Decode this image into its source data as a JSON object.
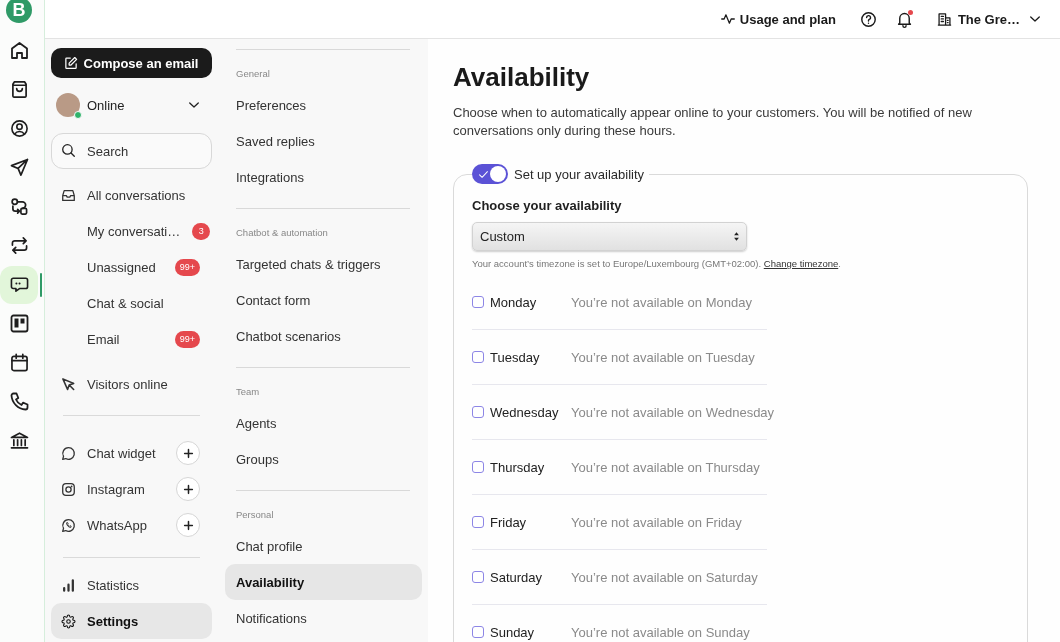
{
  "rail": {
    "logo": "B",
    "items": [
      {
        "selected": false
      },
      {
        "selected": false
      },
      {
        "selected": false
      },
      {
        "selected": false
      },
      {
        "selected": false
      },
      {
        "selected": false
      },
      {
        "selected": true
      },
      {
        "selected": false
      },
      {
        "selected": false
      },
      {
        "selected": false
      },
      {
        "selected": false
      }
    ]
  },
  "header": {
    "usage": "Usage and plan",
    "notifications": {
      "unread": true
    },
    "account": "The Gre…"
  },
  "nav": {
    "compose": "Compose an email",
    "status": {
      "label": "Online"
    },
    "search": {
      "placeholder": "Search"
    },
    "inbox": {
      "label": "All conversations",
      "selected": false,
      "children": [
        {
          "label": "My conversati…",
          "badge": "3",
          "selected": false
        },
        {
          "label": "Unassigned",
          "badge": "99+",
          "selected": false
        },
        {
          "label": "Chat & social",
          "selected": false
        },
        {
          "label": "Email",
          "badge": "99+",
          "selected": false
        }
      ]
    },
    "visitors": {
      "label": "Visitors online",
      "selected": false
    },
    "channels": [
      {
        "label": "Chat widget",
        "selected": false
      },
      {
        "label": "Instagram",
        "selected": false
      },
      {
        "label": "WhatsApp",
        "selected": false
      }
    ],
    "bottom": [
      {
        "label": "Statistics",
        "selected": false
      },
      {
        "label": "Settings",
        "selected": true
      }
    ]
  },
  "menu": {
    "sections": [
      {
        "title": "General",
        "items": [
          {
            "label": "Preferences",
            "selected": false
          },
          {
            "label": "Saved replies",
            "selected": false
          },
          {
            "label": "Integrations",
            "selected": false
          }
        ]
      },
      {
        "title": "Chatbot & automation",
        "items": [
          {
            "label": "Targeted chats & triggers",
            "selected": false
          },
          {
            "label": "Contact form",
            "selected": false
          },
          {
            "label": "Chatbot scenarios",
            "selected": false
          }
        ]
      },
      {
        "title": "Team",
        "items": [
          {
            "label": "Agents",
            "selected": false
          },
          {
            "label": "Groups",
            "selected": false
          }
        ]
      },
      {
        "title": "Personal",
        "items": [
          {
            "label": "Chat profile",
            "selected": false
          },
          {
            "label": "Availability",
            "selected": true
          },
          {
            "label": "Notifications",
            "selected": false
          }
        ]
      }
    ]
  },
  "page": {
    "title": "Availability",
    "description": "Choose when to automatically appear online to your customers. You will be notified of new conversations only during these hours.",
    "toggle": {
      "label": "Set up your availability",
      "on": true
    },
    "choose_label": "Choose your availability",
    "select": {
      "value": "Custom"
    },
    "hint": {
      "text": "Your account’s timezone is set to Europe/Luxembourg (GMT+02:00).",
      "link": "Change timezone",
      "end": "."
    },
    "days": [
      {
        "day": "Monday",
        "checked": false,
        "status": "You’re not available on Monday"
      },
      {
        "day": "Tuesday",
        "checked": false,
        "status": "You’re not available on Tuesday"
      },
      {
        "day": "Wednesday",
        "checked": false,
        "status": "You’re not available on Wednesday"
      },
      {
        "day": "Thursday",
        "checked": false,
        "status": "You’re not available on Thursday"
      },
      {
        "day": "Friday",
        "checked": false,
        "status": "You’re not available on Friday"
      },
      {
        "day": "Saturday",
        "checked": false,
        "status": "You’re not available on Saturday"
      },
      {
        "day": "Sunday",
        "checked": false,
        "status": "You’re not available on Sunday"
      }
    ]
  }
}
